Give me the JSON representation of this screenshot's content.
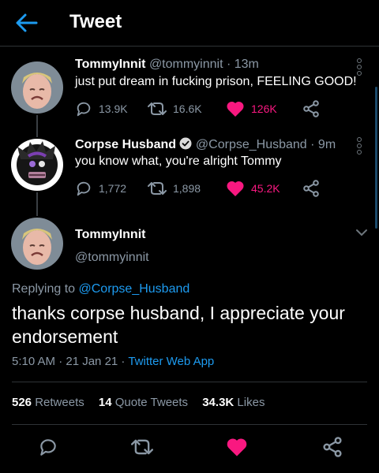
{
  "header": {
    "title": "Tweet"
  },
  "thread": [
    {
      "name": "TommyInnit",
      "handle": "@tommyinnit",
      "time": "· 13m",
      "text": "just put dream in fucking prison, FEELING GOOD!",
      "replies": "13.9K",
      "retweets": "16.6K",
      "likes": "126K",
      "avatar_color": "#8d9aa6"
    },
    {
      "name": "Corpse Husband",
      "verified": true,
      "handle": "@Corpse_Husband",
      "time": "· 9m",
      "text": "you know what, you're alright Tommy",
      "replies": "1,772",
      "retweets": "1,898",
      "likes": "45.2K",
      "avatar_color": "#ffffff"
    }
  ],
  "main_tweet": {
    "name": "TommyInnit",
    "handle": "@tommyinnit",
    "replying_prefix": "Replying to",
    "replying_handle": "@Corpse_Husband",
    "text": "thanks corpse husband, I appreciate your endorsement",
    "time": "5:10 AM · 21 Jan 21 ·",
    "app": "Twitter Web App",
    "retweet_count": "526",
    "retweet_label": "Retweets",
    "quote_count": "14",
    "quote_label": "Quote Tweets",
    "like_count": "34.3K",
    "like_label": "Likes"
  },
  "colors": {
    "accent": "#1d9bf0",
    "like": "#f91880",
    "muted": "#8b98a5"
  }
}
